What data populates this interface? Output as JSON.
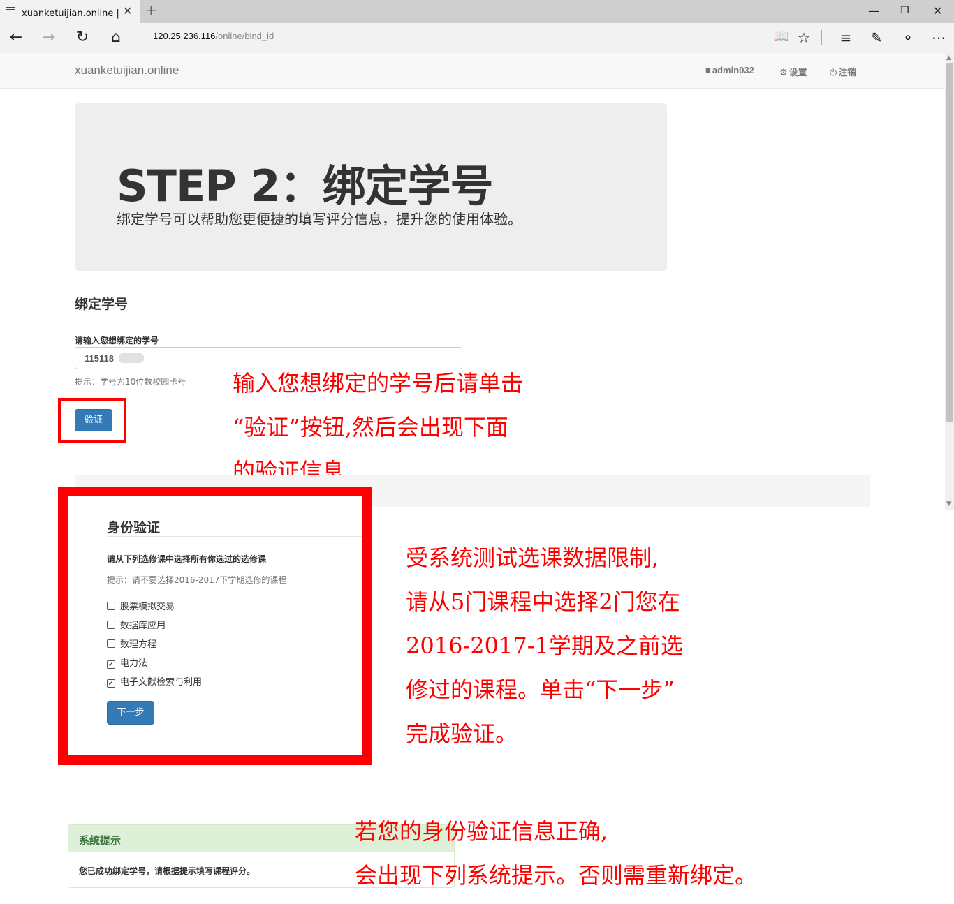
{
  "browser": {
    "tab_title": "xuanketuijian.online | 基",
    "tab_close": "✕",
    "new_tab": "+",
    "url_host": "120.25.236.116",
    "url_path": "/online/bind_id"
  },
  "navbar": {
    "brand": "xuanketuijian.online",
    "user": "admin032",
    "settings": "设置",
    "logout": "注销"
  },
  "jumbotron": {
    "title": "STEP 2：绑定学号",
    "subtitle": "绑定学号可以帮助您更便捷的填写评分信息，提升您的使用体验。"
  },
  "bind_form": {
    "heading": "绑定学号",
    "label": "请输入您想绑定的学号",
    "value": "115118",
    "help": "提示：学号为10位数校园卡号",
    "verify_button": "验证"
  },
  "notes": {
    "note1": [
      "输入您想绑定的学号后请单击",
      "“验证”按钮,然后会出现下面",
      "的验证信息"
    ],
    "note2": [
      "受系统测试选课数据限制,",
      "请从5门课程中选择2门您在",
      "2016-2017-1学期及之前选",
      "修过的课程。单击“下一步”",
      "完成验证。"
    ],
    "note3": [
      "若您的身份验证信息正确,",
      "会出现下列系统提示。否则需重新绑定。"
    ]
  },
  "verification": {
    "heading": "身份验证",
    "question": "请从下列选修课中选择所有你选过的选修课",
    "hint": "提示：请不要选择2016-2017下学期选修的课程",
    "courses": [
      {
        "label": "股票模拟交易",
        "checked": false
      },
      {
        "label": "数据库应用",
        "checked": false
      },
      {
        "label": "数理方程",
        "checked": false
      },
      {
        "label": "电力法",
        "checked": true
      },
      {
        "label": "电子文献检索与利用",
        "checked": true
      }
    ],
    "next_button": "下一步"
  },
  "alert": {
    "title": "系统提示",
    "message": "您已成功绑定学号，请根据提示填写课程评分。"
  },
  "colors": {
    "primary": "#337ab7",
    "annotation_red": "#ff0000",
    "success_bg": "#dff0d8",
    "success_text": "#3c763d"
  }
}
